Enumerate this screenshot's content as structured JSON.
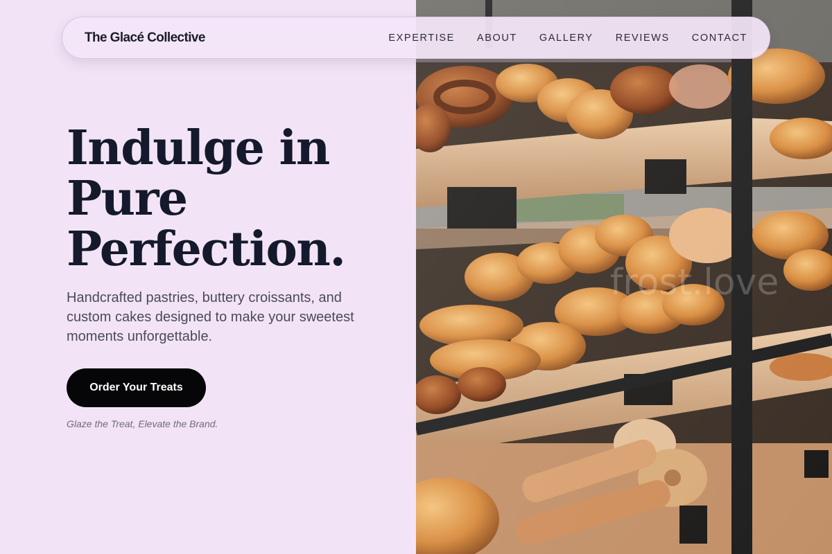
{
  "brand": "The Glacé Collective",
  "nav": {
    "items": [
      {
        "label": "EXPERTISE"
      },
      {
        "label": "ABOUT"
      },
      {
        "label": "GALLERY"
      },
      {
        "label": "REVIEWS"
      },
      {
        "label": "CONTACT"
      }
    ]
  },
  "hero": {
    "headline_lines": [
      "Indulge in",
      "Pure",
      "Perfection."
    ],
    "subtitle": "Handcrafted pastries, buttery croissants, and custom cakes designed to make your sweetest moments unforgettable.",
    "cta_label": "Order Your Treats",
    "tagline": "Glaze the Treat, Elevate the Brand."
  },
  "photo": {
    "description": "bakery-display-case-photo",
    "watermark": "frost.love"
  },
  "colors": {
    "background": "#f2e4f6",
    "headline": "#141a2b",
    "cta_bg": "#060608",
    "cta_text": "#ffffff",
    "body_text": "#4a4a58"
  }
}
